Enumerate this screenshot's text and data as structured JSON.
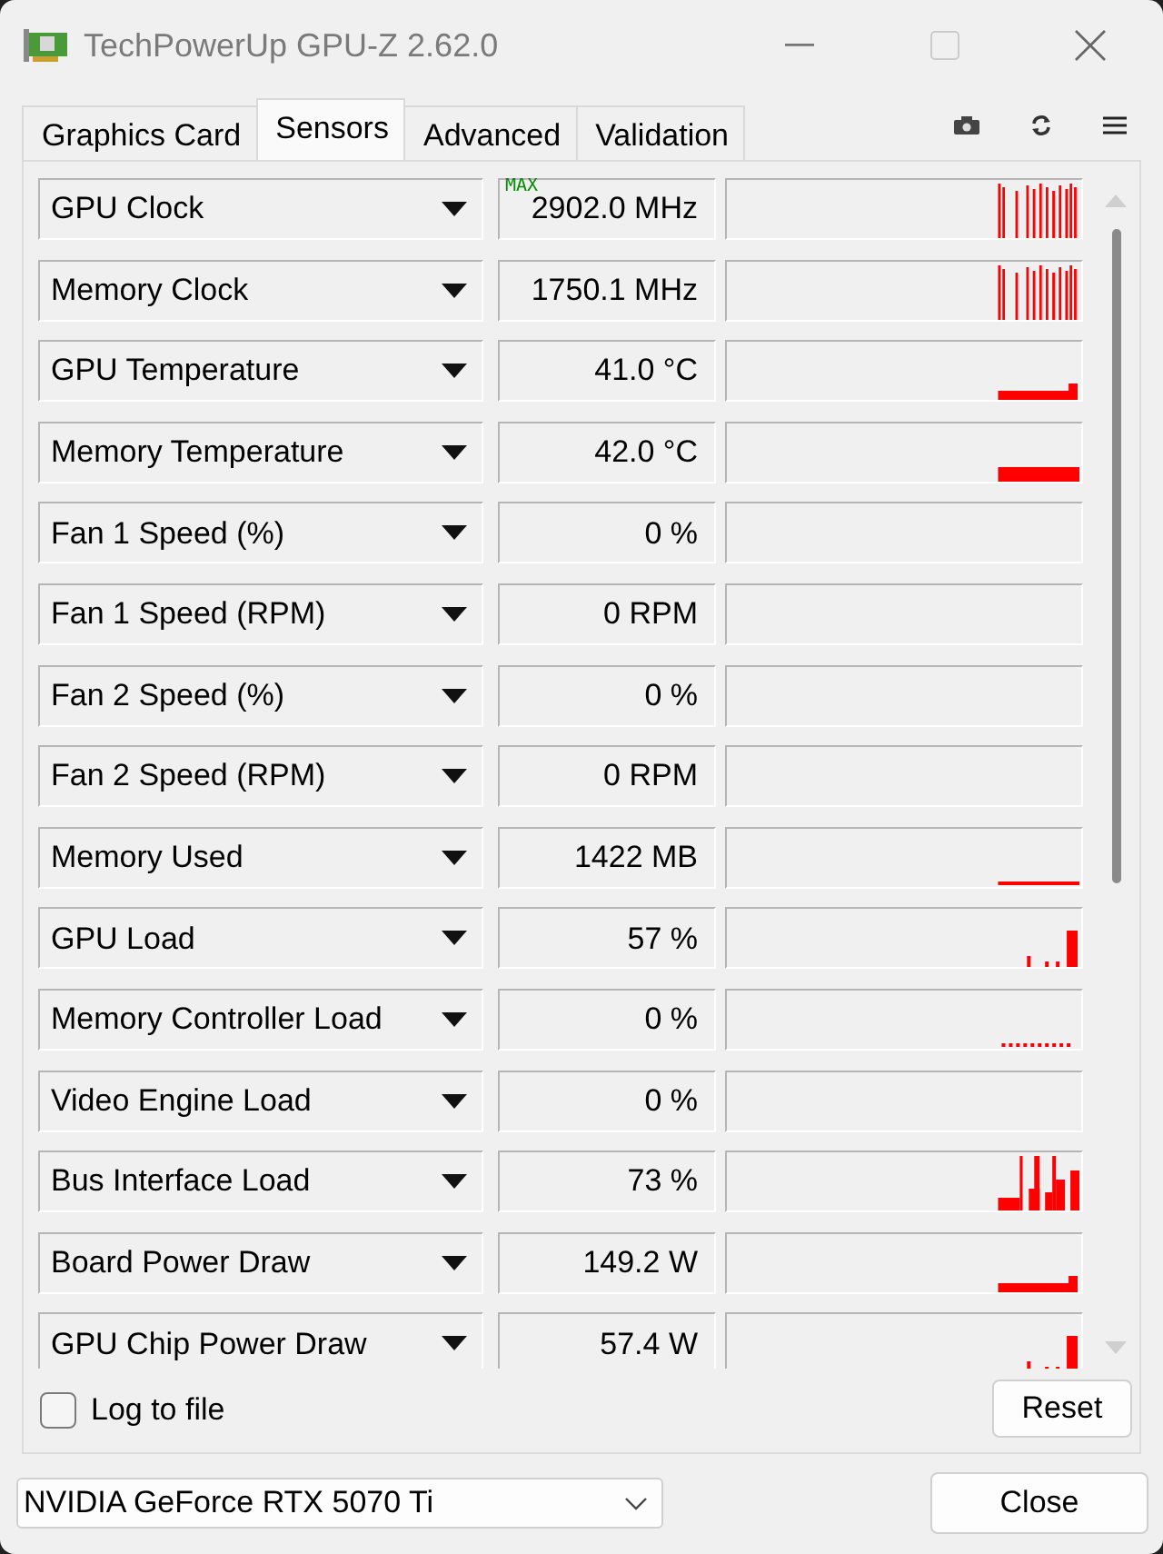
{
  "window": {
    "title": "TechPowerUp GPU-Z 2.62.0"
  },
  "tabs": [
    {
      "label": "Graphics Card",
      "selected": false
    },
    {
      "label": "Sensors",
      "selected": true
    },
    {
      "label": "Advanced",
      "selected": false
    },
    {
      "label": "Validation",
      "selected": false
    }
  ],
  "sensors": [
    {
      "name": "GPU Clock",
      "value": "2902.0 MHz",
      "badge": "MAX",
      "kind": "spikes"
    },
    {
      "name": "Memory Clock",
      "value": "1750.1 MHz",
      "kind": "spikes"
    },
    {
      "name": "GPU Temperature",
      "value": "41.0 °C",
      "kind": "low"
    },
    {
      "name": "Memory Temperature",
      "value": "42.0 °C",
      "kind": "band"
    },
    {
      "name": "Fan 1 Speed (%)",
      "value": "0 %",
      "kind": "empty"
    },
    {
      "name": "Fan 1 Speed (RPM)",
      "value": "0 RPM",
      "kind": "empty"
    },
    {
      "name": "Fan 2 Speed (%)",
      "value": "0 %",
      "kind": "empty"
    },
    {
      "name": "Fan 2 Speed (RPM)",
      "value": "0 RPM",
      "kind": "empty"
    },
    {
      "name": "Memory Used",
      "value": "1422 MB",
      "kind": "line"
    },
    {
      "name": "GPU Load",
      "value": "57 %",
      "kind": "rise"
    },
    {
      "name": "Memory Controller Load",
      "value": "0 %",
      "kind": "dots"
    },
    {
      "name": "Video Engine Load",
      "value": "0 %",
      "kind": "empty"
    },
    {
      "name": "Bus Interface Load",
      "value": "73 %",
      "kind": "peaks"
    },
    {
      "name": "Board Power Draw",
      "value": "149.2 W",
      "kind": "low"
    },
    {
      "name": "GPU Chip Power Draw",
      "value": "57.4 W",
      "kind": "rise"
    }
  ],
  "log_to_file": {
    "label": "Log to file",
    "checked": false
  },
  "reset_button": "Reset",
  "gpu_select": {
    "value": "NVIDIA GeForce RTX 5070 Ti"
  },
  "close_button": "Close"
}
